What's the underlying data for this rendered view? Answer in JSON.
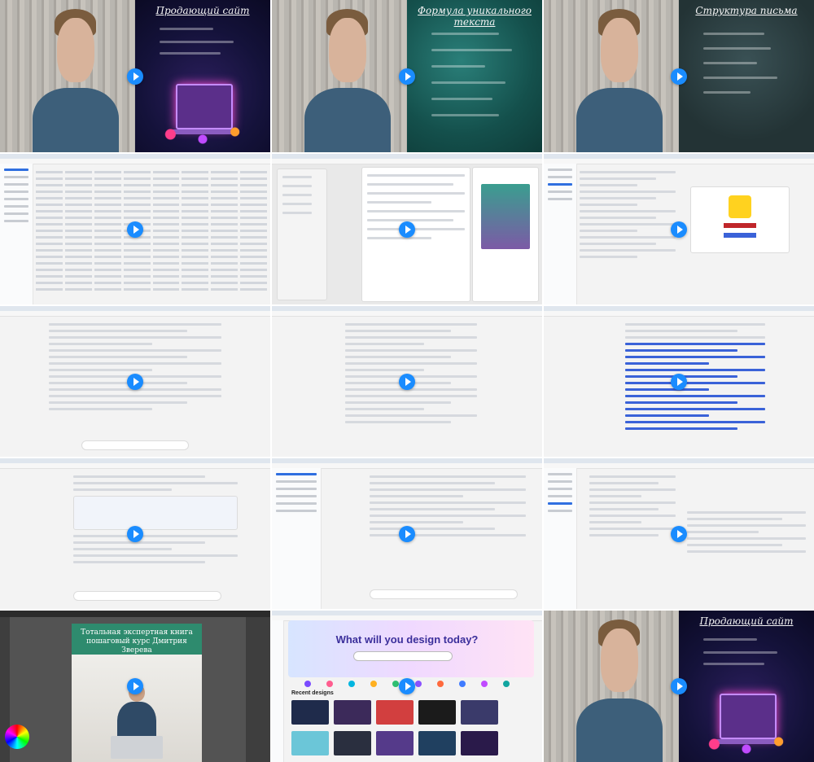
{
  "tiles": [
    {
      "kind": "video",
      "board": "dark",
      "title": "Продающий сайт",
      "play": "play-button"
    },
    {
      "kind": "video",
      "board": "teal",
      "title": "Формула уникального текста",
      "play": "play-button"
    },
    {
      "kind": "video",
      "board": "gray",
      "title": "Структура письма",
      "play": "play-button"
    },
    {
      "kind": "screen",
      "app": "crm-table"
    },
    {
      "kind": "screen",
      "app": "settings-editor"
    },
    {
      "kind": "screen",
      "app": "profile-form"
    },
    {
      "kind": "screen",
      "app": "chatgpt-chat"
    },
    {
      "kind": "screen",
      "app": "chatgpt-chat"
    },
    {
      "kind": "screen",
      "app": "chatgpt-chat"
    },
    {
      "kind": "screen",
      "app": "chatgpt-chat"
    },
    {
      "kind": "screen",
      "app": "generator"
    },
    {
      "kind": "screen",
      "app": "chatgpt-chat"
    },
    {
      "kind": "editor",
      "cover_title": "Тотальная экспертная книга",
      "cover_subtitle": "пошаговый курс Дмитрия Зверева"
    },
    {
      "kind": "canva",
      "headline": "What will you design today?",
      "recent": "Recent designs"
    },
    {
      "kind": "video",
      "board": "dark",
      "title": "Продающий сайт",
      "play": "play-button"
    }
  ],
  "colors": {
    "accent": "#1a8cff",
    "brand": "#3b2f9b"
  }
}
